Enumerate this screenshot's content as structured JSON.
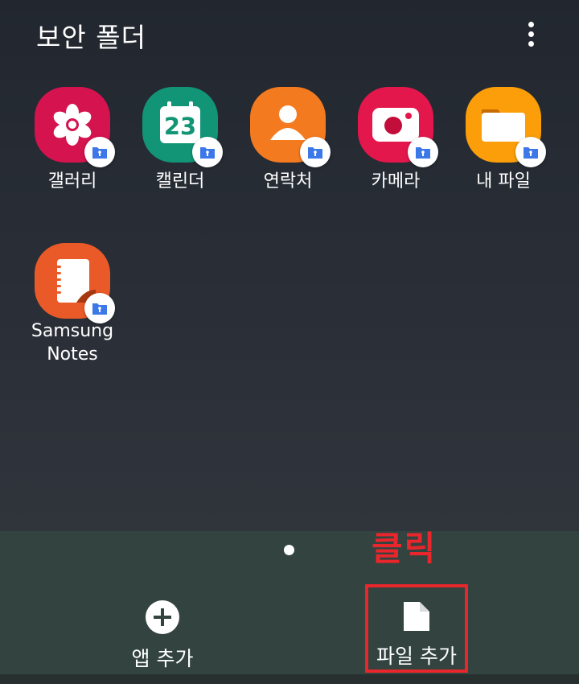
{
  "header": {
    "title": "보안 폴더"
  },
  "apps": [
    {
      "label": "갤러리",
      "icon": "gallery-icon",
      "color": "#d4134f"
    },
    {
      "label": "캘린더",
      "icon": "calendar-icon",
      "color": "#129477",
      "date": "23"
    },
    {
      "label": "연락처",
      "icon": "contacts-icon",
      "color": "#f47a20"
    },
    {
      "label": "카메라",
      "icon": "camera-icon",
      "color": "#e3174c"
    },
    {
      "label": "내 파일",
      "icon": "my-files-icon",
      "color": "#fb9e0a"
    },
    {
      "label": "Samsung\nNotes",
      "icon": "samsung-notes-icon",
      "color": "#ea5a28"
    }
  ],
  "dock": {
    "add_app_label": "앱 추가",
    "add_file_label": "파일 추가",
    "annotation": "클릭"
  },
  "colors": {
    "badge_folder": "#3d78e8",
    "annotation": "#e8262b"
  }
}
